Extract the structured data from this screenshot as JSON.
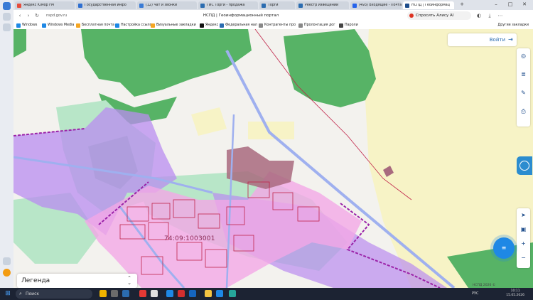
{
  "browser": {
    "tabs": [
      {
        "title": "Яндекс Юмор FM",
        "color": "#e74c3c",
        "active": false
      },
      {
        "title": "Государственная инфо",
        "color": "#2f6fd1",
        "active": false
      },
      {
        "title": "(12) Чат и звонки",
        "color": "#3a7bd5",
        "active": false
      },
      {
        "title": "ГИС Торги - продажа",
        "color": "#2b6cb0",
        "active": false
      },
      {
        "title": "Торги",
        "color": "#2b6cb0",
        "active": false
      },
      {
        "title": "Реестр извещений",
        "color": "#2b6cb0",
        "active": false
      },
      {
        "title": "(493) Входящие - Почта",
        "color": "#2563eb",
        "active": false
      },
      {
        "title": "НСПД | Геоинформац",
        "color": "#1f4e8c",
        "active": true
      }
    ],
    "address": "nspd.gov.ru",
    "page_title": "НСПД | Геоинформационный портал",
    "alisa_label": "Спросить Алису AI",
    "bookmarks": [
      {
        "label": "Windows",
        "color": "#1e88e5"
      },
      {
        "label": "Windows Media",
        "color": "#1e88e5"
      },
      {
        "label": "Бесплатная почта",
        "color": "#f5a623"
      },
      {
        "label": "Настройка ссылок",
        "color": "#1e88e5"
      },
      {
        "label": "Визуальные закладки",
        "color": "#f5a623"
      },
      {
        "label": "Яндекс",
        "color": "#111111"
      },
      {
        "label": "Федеральная нал",
        "color": "#2b6cb0"
      },
      {
        "label": "Контрагенты про",
        "color": "#888888"
      },
      {
        "label": "Пролонгация дог",
        "color": "#888888"
      },
      {
        "label": "Пароли",
        "color": "#444444"
      }
    ],
    "all_bookmarks_label": "Другие закладки"
  },
  "map": {
    "cadastral_number": "74:09:1003001",
    "login_label": "Войти",
    "legend_label": "Легенда",
    "scale_text": "НСПД 2026 ©",
    "tools_top": [
      "globe-icon",
      "layers-icon",
      "ruler-icon",
      "print-icon"
    ],
    "tools_bottom": [
      "locate-icon",
      "layout-icon",
      "zoom-in-icon",
      "zoom-out-icon"
    ],
    "colors": {
      "forest": "#57b366",
      "farmland": "#f7f3c6",
      "zone_purple": "#b98cf0",
      "zone_pink": "#f2a8e6",
      "meadow": "#b8e6c8",
      "water_blue": "#9fb4ec",
      "parcel_brown": "#a86a7e",
      "road": "#9fb0ef",
      "boundary": "#9b22a8",
      "parcel_line": "#c0254a"
    }
  },
  "taskbar": {
    "search_label": "Поиск",
    "language": "РУС",
    "time": "10:11",
    "date": "15.05.2026"
  }
}
